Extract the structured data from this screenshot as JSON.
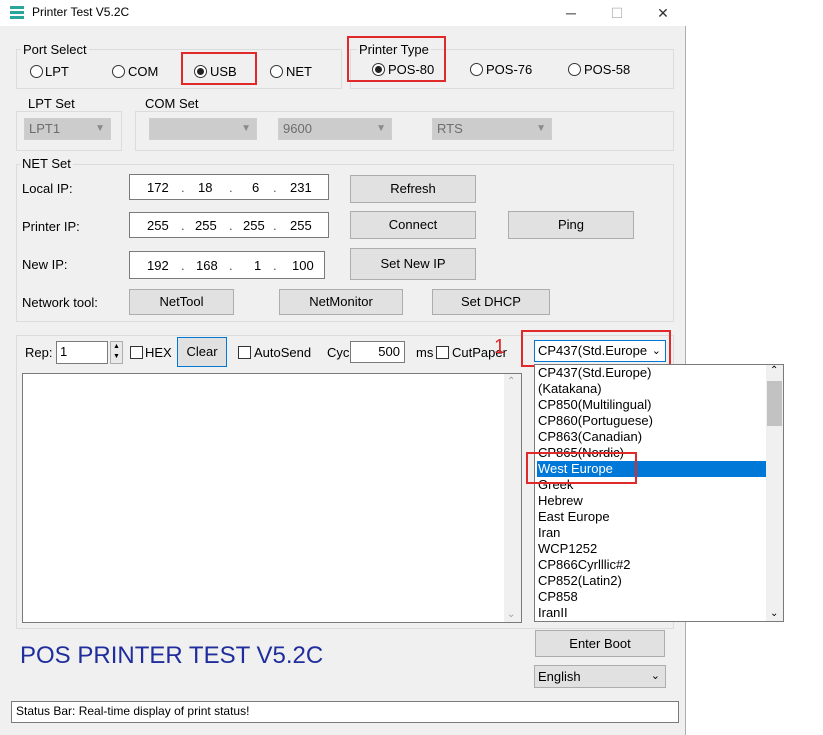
{
  "window": {
    "title": "Printer Test V5.2C",
    "minimize_label": "─",
    "maximize_label": "☐",
    "close_label": "✕"
  },
  "port_select": {
    "label": "Port Select",
    "options": [
      "LPT",
      "COM",
      "USB",
      "NET"
    ],
    "selected": "USB"
  },
  "printer_type": {
    "label": "Printer Type",
    "options": [
      "POS-80",
      "POS-76",
      "POS-58"
    ],
    "selected": "POS-80"
  },
  "lpt_set": {
    "label": "LPT Set",
    "port_value": "LPT1"
  },
  "com_set": {
    "label": "COM Set",
    "port_value": "",
    "baud_value": "9600",
    "flow_value": "RTS"
  },
  "net_set": {
    "label": "NET Set",
    "local_ip_label": "Local IP:",
    "local_ip": [
      "172",
      "18",
      "6",
      "231"
    ],
    "printer_ip_label": "Printer IP:",
    "printer_ip": [
      "255",
      "255",
      "255",
      "255"
    ],
    "new_ip_label": "New IP:",
    "new_ip": [
      "192",
      "168",
      "1",
      "100"
    ],
    "refresh_label": "Refresh",
    "connect_label": "Connect",
    "ping_label": "Ping",
    "set_new_ip_label": "Set New IP",
    "network_tool_label": "Network tool:",
    "nettool_label": "NetTool",
    "netmonitor_label": "NetMonitor",
    "setdhcp_label": "Set DHCP"
  },
  "toolbar": {
    "rep_label": "Rep:",
    "rep_value": "1",
    "hex_label": "HEX",
    "clear_label": "Clear",
    "autosend_label": "AutoSend",
    "cycle_label": "Cyc",
    "cycle_value": "500",
    "ms_label": "ms",
    "cutpaper_label": "CutPaper"
  },
  "codepage": {
    "selected": "CP437(Std.Europe",
    "annotation": "1",
    "options": [
      "CP437(Std.Europe)",
      "(Katakana)",
      "CP850(Multilingual)",
      "CP860(Portuguese)",
      "CP863(Canadian)",
      "CP865(Nordic)",
      "West Europe",
      "Greek",
      "Hebrew",
      "East Europe",
      "Iran",
      "WCP1252",
      "CP866Cyrlllic#2",
      "CP852(Latin2)",
      "CP858",
      "IranII"
    ],
    "highlighted": "West Europe"
  },
  "footer": {
    "app_caption": "POS PRINTER TEST V5.2C",
    "enter_boot_label": "Enter Boot",
    "language_value": "English",
    "status_text": "Status Bar: Real-time display of print status!"
  },
  "colors": {
    "accent": "#0078d7",
    "caption": "#1f2e9c",
    "highlight_box": "#e02a2a",
    "icon": "#2aa59a"
  }
}
